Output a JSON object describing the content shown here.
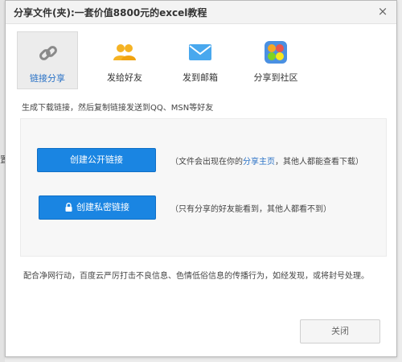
{
  "page": {
    "edge_char": "置"
  },
  "dialog": {
    "title": "分享文件(夹):一套价值8800元的excel教程",
    "close_glyph": "×"
  },
  "tabs": [
    {
      "label": "链接分享",
      "icon": "link-icon",
      "active": true
    },
    {
      "label": "发给好友",
      "icon": "friends-icon",
      "active": false
    },
    {
      "label": "发到邮箱",
      "icon": "mail-icon",
      "active": false
    },
    {
      "label": "分享到社区",
      "icon": "community-icon",
      "active": false
    }
  ],
  "description": "生成下载链接，然后复制链接发送到QQ、MSN等好友",
  "public_link": {
    "button_label": "创建公开链接",
    "note_prefix": "（文件会出现在你的",
    "note_link": "分享主页",
    "note_suffix": "，其他人都能查看下载）"
  },
  "private_link": {
    "button_label": "创建私密链接",
    "icon": "lock-icon",
    "note": "（只有分享的好友能看到，其他人都看不到）"
  },
  "footer_notice": "配合净网行动，百度云严厉打击不良信息、色情低俗信息的传播行为，如经发现，或将封号处理。",
  "close_button_label": "关闭",
  "colors": {
    "primary": "#1a85e2",
    "link": "#2a72c6",
    "panel_bg": "#f7f7f7"
  }
}
